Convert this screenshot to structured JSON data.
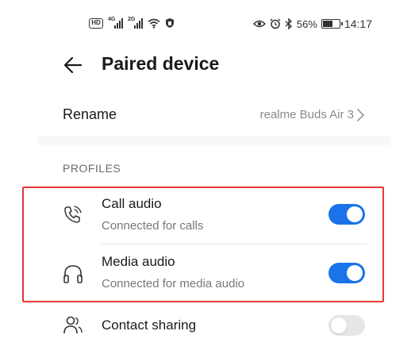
{
  "status_bar": {
    "hd_badge": "HD",
    "network_1": "4G",
    "network_2": "2G",
    "battery_percent": "56%",
    "time": "14:17",
    "left_icons": [
      "hd-voice-icon",
      "signal-4g-icon",
      "signal-2g-icon",
      "wifi-icon",
      "shield-icon"
    ],
    "right_icons": [
      "eye-comfort-icon",
      "alarm-icon",
      "bluetooth-icon",
      "battery-icon"
    ]
  },
  "header": {
    "title": "Paired device",
    "back_icon": "arrow-left-icon"
  },
  "rename": {
    "label": "Rename",
    "value": "realme Buds Air 3"
  },
  "profiles": {
    "section_label": "PROFILES",
    "items": [
      {
        "title": "Call audio",
        "subtitle": "Connected for calls",
        "icon": "phone-call-icon",
        "enabled": true
      },
      {
        "title": "Media audio",
        "subtitle": "Connected for media audio",
        "icon": "headphones-icon",
        "enabled": true
      },
      {
        "title": "Contact sharing",
        "subtitle": "",
        "icon": "contacts-icon",
        "enabled": false
      }
    ]
  },
  "colors": {
    "toggle_on": "#1a73e8",
    "toggle_off": "#e6e6e6",
    "highlight_border": "#e53935"
  }
}
